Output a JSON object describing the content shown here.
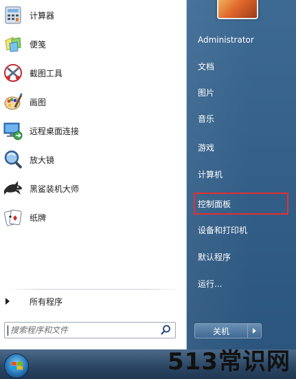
{
  "programs": [
    {
      "label": "计算器",
      "icon": "calculator-icon"
    },
    {
      "label": "便笺",
      "icon": "sticky-notes-icon"
    },
    {
      "label": "截图工具",
      "icon": "snipping-tool-icon"
    },
    {
      "label": "画图",
      "icon": "paint-icon"
    },
    {
      "label": "远程桌面连接",
      "icon": "remote-desktop-icon"
    },
    {
      "label": "放大镜",
      "icon": "magnifier-icon"
    },
    {
      "label": "黑鲨装机大师",
      "icon": "shark-icon"
    },
    {
      "label": "纸牌",
      "icon": "solitaire-icon"
    }
  ],
  "all_programs": {
    "label": "所有程序"
  },
  "search": {
    "placeholder": "搜索程序和文件"
  },
  "right_items": [
    {
      "label": "Administrator"
    },
    {
      "label": "文档"
    },
    {
      "label": "图片"
    },
    {
      "label": "音乐"
    },
    {
      "label": "游戏"
    },
    {
      "label": "计算机"
    },
    {
      "label": "控制面板",
      "highlighted": true
    },
    {
      "label": "设备和打印机"
    },
    {
      "label": "默认程序"
    },
    {
      "label": "运行..."
    }
  ],
  "shutdown": {
    "label": "关机"
  },
  "watermark": {
    "text": "513常识网"
  },
  "colors": {
    "highlight_border": "#e62e2e",
    "right_panel": "#35618a"
  }
}
